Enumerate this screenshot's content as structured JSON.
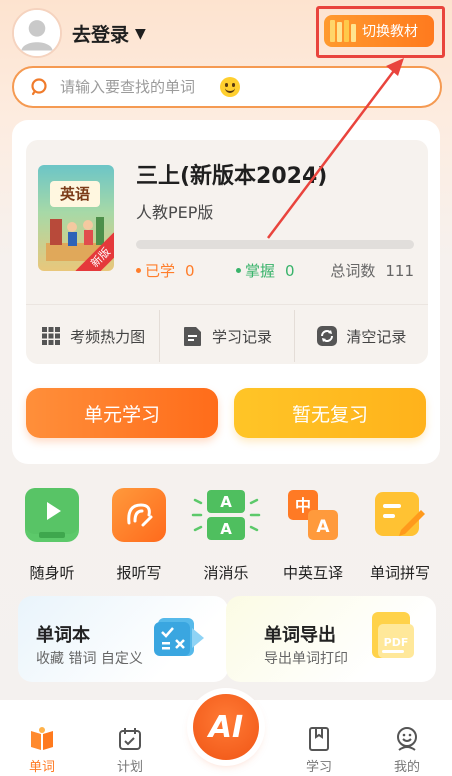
{
  "header": {
    "login_label": "去登录",
    "login_caret": "▼",
    "switch_label": "切换教材"
  },
  "search": {
    "placeholder": "请输入要查找的单词"
  },
  "book": {
    "cover_title": "英语",
    "cover_badge": "新版",
    "title": "三上(新版本2024)",
    "edition": "人教PEP版",
    "progress": 0,
    "learned_label": "已学",
    "learned_value": "0",
    "mastered_label": "掌握",
    "mastered_value": "0",
    "total_label": "总词数",
    "total_value": "111"
  },
  "actions": [
    {
      "label": "考频热力图",
      "icon": "grid-icon"
    },
    {
      "label": "学习记录",
      "icon": "document-icon"
    },
    {
      "label": "清空记录",
      "icon": "refresh-icon"
    }
  ],
  "buttons": {
    "unit_study": "单元学习",
    "review": "暂无复习"
  },
  "features": [
    {
      "label": "随身听",
      "icon": "play-icon"
    },
    {
      "label": "报听写",
      "icon": "ear-icon"
    },
    {
      "label": "消消乐",
      "icon": "match-icon"
    },
    {
      "label": "中英互译",
      "icon": "translate-icon"
    },
    {
      "label": "单词拼写",
      "icon": "pencil-icon"
    }
  ],
  "wordbook": {
    "title": "单词本",
    "subtitle": "收藏 错词 自定义"
  },
  "export": {
    "title": "单词导出",
    "subtitle": "导出单词打印",
    "icon_text": "PDF"
  },
  "feature_icon_text": {
    "match_top": "A",
    "match_bottom": "A",
    "trans_cn": "中",
    "trans_en": "A"
  },
  "nav": {
    "words": "单词",
    "plan": "计划",
    "ai": "AI",
    "study": "学习",
    "me": "我的"
  },
  "colors": {
    "accent": "#ff7a24",
    "highlight_annotation": "#e9443d",
    "mastered": "#38b36a"
  }
}
